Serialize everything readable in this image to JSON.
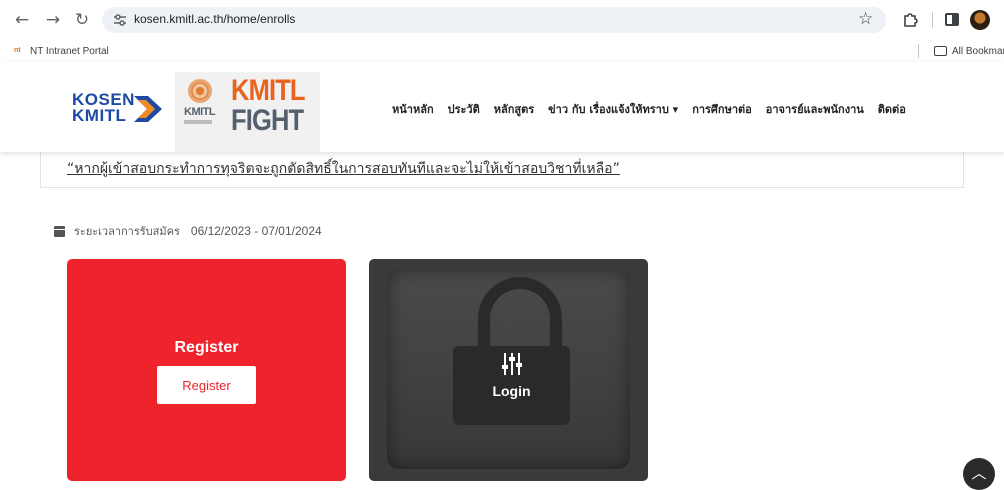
{
  "browser": {
    "url": "kosen.kmitl.ac.th/home/enrolls",
    "bookmark_intranet": "NT Intranet Portal",
    "bookmark_favicon": "nt",
    "all_bookmarks": "All Bookmar"
  },
  "header": {
    "kosen_logo_line1": "KOSEN",
    "kosen_logo_line2": "KMITL",
    "kmitl_logo_small": "KMITL",
    "kmitl_logo_big_1": "KMITL",
    "kmitl_logo_big_2": "FIGHT",
    "nav": [
      {
        "label": "หน้าหลัก"
      },
      {
        "label": "ประวัติ"
      },
      {
        "label": "หลักสูตร"
      },
      {
        "label": "ข่าว กับ เรื่องแจ้งให้ทราบ ▾"
      },
      {
        "label": "การศึกษาต่อ"
      },
      {
        "label": "อาจารย์และพนักงาน"
      },
      {
        "label": "ติดต่อ"
      }
    ]
  },
  "notice": {
    "text": "“หากผู้เข้าสอบกระทำการทุจริตจะถูกตัดสิทธิ์ในการสอบทันทีและจะไม่ให้เข้าสอบวิชาที่เหลือ”"
  },
  "enroll": {
    "period_label": "ระยะเวลาการรับสมัคร",
    "period_dates": "06/12/2023 - 07/01/2024"
  },
  "cards": {
    "register_title": "Register",
    "register_button": "Register",
    "login_title": "Login"
  },
  "colors": {
    "register_red": "#ef232c",
    "login_dark": "#3a3a3a",
    "kosen_blue": "#1f4aa3",
    "kosen_orange": "#f08a24",
    "kmitl_orange": "#e8631d",
    "kmitl_gray": "#55606e"
  },
  "icons": {
    "back": "arrow-left-icon",
    "forward": "arrow-right-icon",
    "reload": "reload-icon",
    "bookmark_star": "star-icon",
    "calendar": "calendar-icon",
    "lock": "lock-icon",
    "sliders": "sliders-icon",
    "scroll_top": "chevron-up-icon"
  }
}
